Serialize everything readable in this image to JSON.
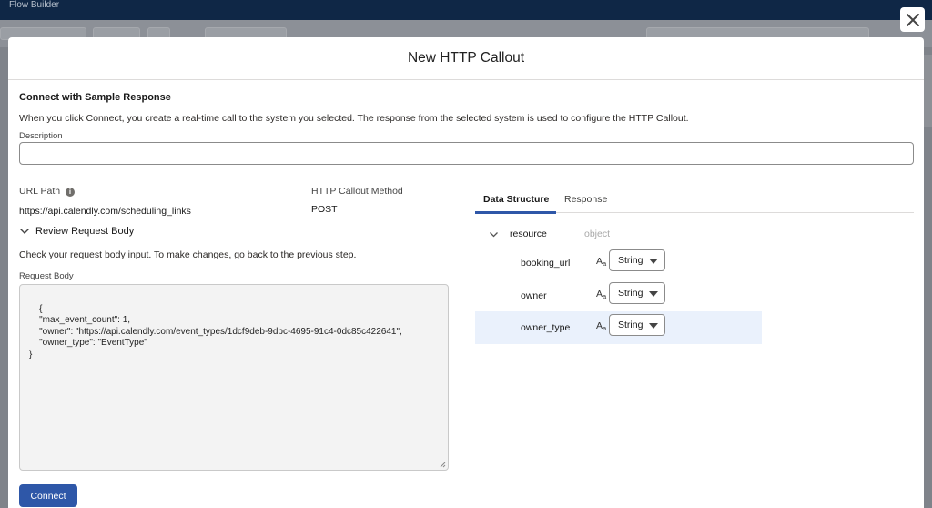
{
  "app": {
    "title": "Flow Builder"
  },
  "modal": {
    "title": "New HTTP Callout",
    "section_title": "Connect with Sample Response",
    "section_description": "When you click Connect, you create a real-time call to the system you selected. The response from the selected system is used to configure the HTTP Callout.",
    "description_label": "Description",
    "description_value": "",
    "url_path_label": "URL Path",
    "url_path_value": "https://api.calendly.com/scheduling_links",
    "method_label": "HTTP Callout Method",
    "method_value": "POST",
    "review_toggle_label": "Review Request Body",
    "review_hint": "Check your request body input. To make changes, go back to the previous step.",
    "request_body_label": "Request Body",
    "request_body": "{\n    \"max_event_count\": 1,\n    \"owner\": \"https://api.calendly.com/event_types/1dcf9deb-9dbc-4695-91c4-0dc85c422641\",\n    \"owner_type\": \"EventType\"\n}",
    "connect_label": "Connect"
  },
  "right_panel": {
    "tabs": [
      {
        "label": "Data Structure",
        "active": true
      },
      {
        "label": "Response",
        "active": false
      }
    ],
    "resource": {
      "name": "resource",
      "type": "object",
      "expanded": true
    },
    "fields": [
      {
        "name": "booking_url",
        "type_glyph_main": "A",
        "type_glyph_sub": "a",
        "type": "String",
        "selected": false
      },
      {
        "name": "owner",
        "type_glyph_main": "A",
        "type_glyph_sub": "a",
        "type": "String",
        "selected": false
      },
      {
        "name": "owner_type",
        "type_glyph_main": "A",
        "type_glyph_sub": "a",
        "type": "String",
        "selected": true
      }
    ]
  },
  "colors": {
    "brand_blue": "#2e57a8",
    "selected_row": "#eaf1fc",
    "header_navy": "#0f2746"
  }
}
